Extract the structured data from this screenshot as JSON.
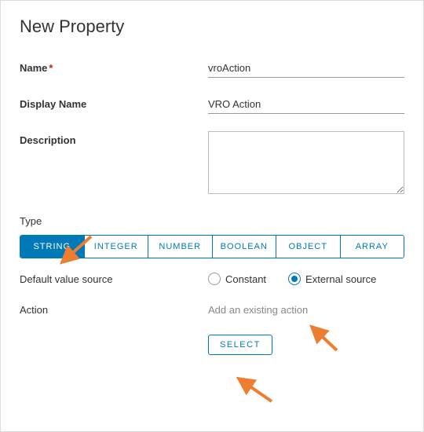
{
  "title": "New Property",
  "fields": {
    "name_label": "Name",
    "name_value": "vroAction",
    "display_label": "Display Name",
    "display_value": "VRO Action",
    "desc_label": "Description",
    "desc_value": ""
  },
  "type": {
    "label": "Type",
    "options": [
      "STRING",
      "INTEGER",
      "NUMBER",
      "BOOLEAN",
      "OBJECT",
      "ARRAY"
    ],
    "selected": "STRING"
  },
  "source": {
    "label": "Default value source",
    "options": {
      "constant": "Constant",
      "external": "External source"
    },
    "selected": "external"
  },
  "action": {
    "label": "Action",
    "hint": "Add an existing action",
    "button": "SELECT"
  }
}
